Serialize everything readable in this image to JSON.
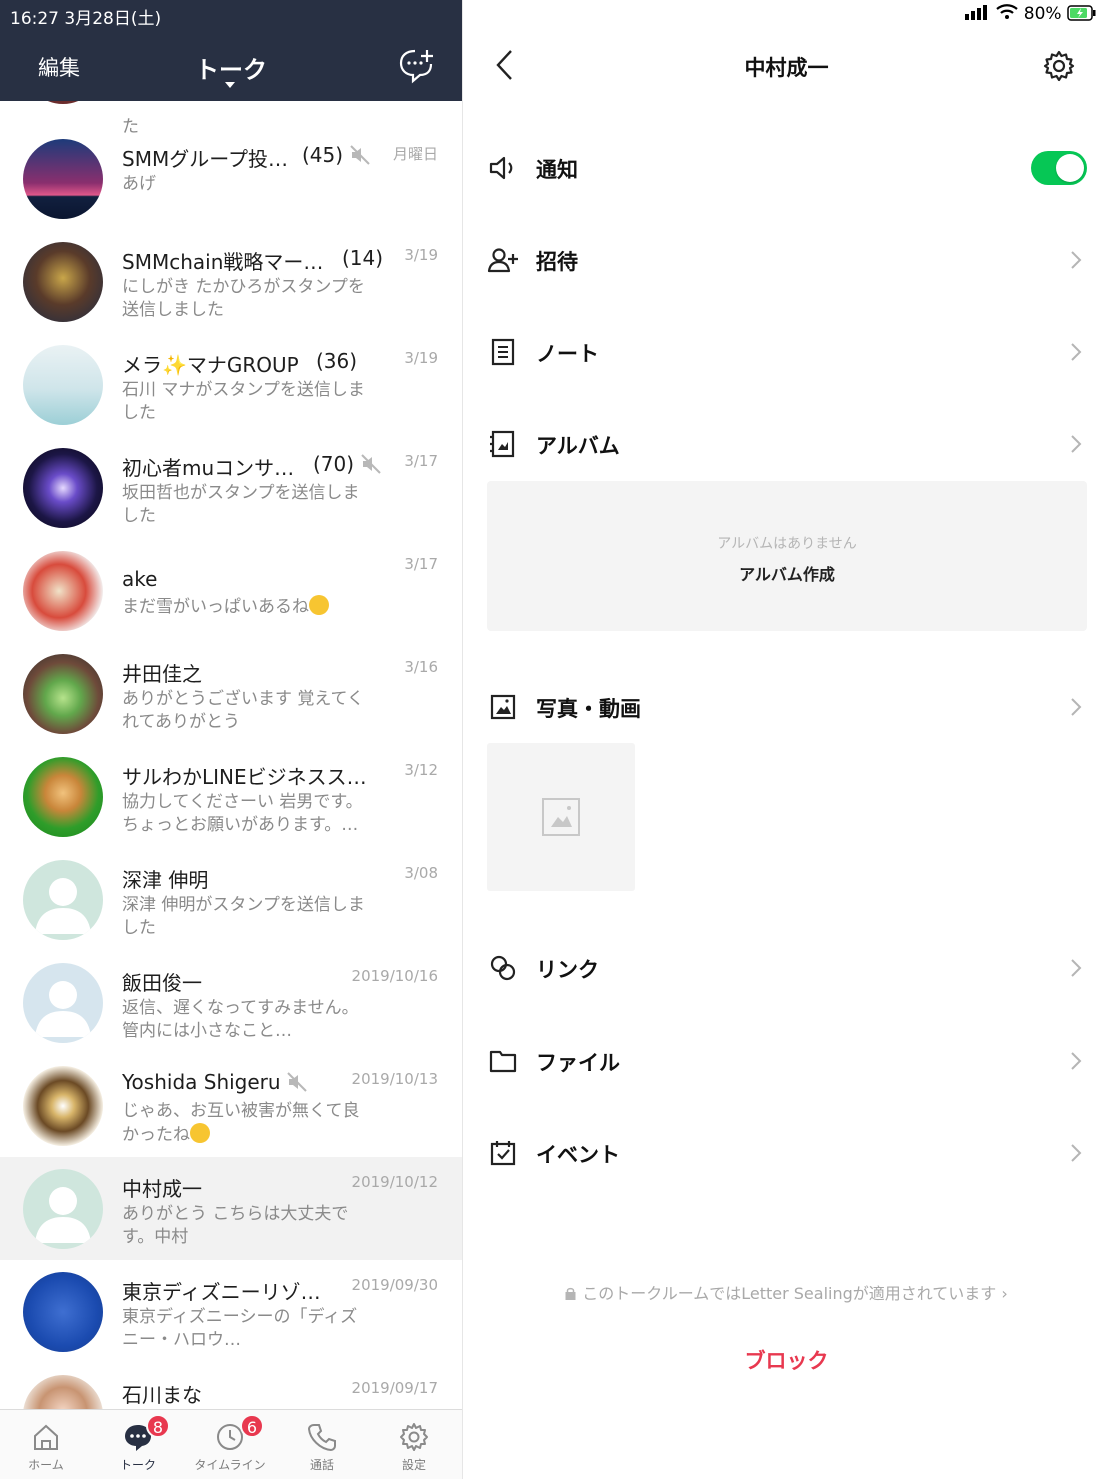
{
  "status_bar": {
    "time_date": "16:27  3月28日(土)",
    "battery": "80%"
  },
  "left_header": {
    "edit_label": "編集",
    "title": "トーク"
  },
  "chats": [
    {
      "name": "SMMグループ投…",
      "count": "(45)",
      "date": "月曜日",
      "message": "あげ",
      "muted": true
    },
    {
      "name": "SMMchain戦略マー…",
      "count": "(14)",
      "date": "3/19",
      "message": "にしがき たかひろがスタンプを送信しました",
      "muted": false
    },
    {
      "name": "メラ✨マナGROUP",
      "count": "(36)",
      "date": "3/19",
      "message": "石川 マナがスタンプを送信しました",
      "muted": false
    },
    {
      "name": "初心者muコンサ…",
      "count": "(70)",
      "date": "3/17",
      "message": "坂田哲也がスタンプを送信しました",
      "muted": true
    },
    {
      "name": "ake",
      "count": "",
      "date": "3/17",
      "message": "まだ雪がいっぱいあるね",
      "muted": false
    },
    {
      "name": "井田佳之",
      "count": "",
      "date": "3/16",
      "message": "ありがとうございます 覚えてくれてありがとう",
      "muted": false
    },
    {
      "name": "サルわかLINEビジネスス…",
      "count": "",
      "date": "3/12",
      "message": "協力してくださーい 岩男です。ちょっとお願いがあります。…",
      "muted": false
    },
    {
      "name": "深津 伸明",
      "count": "",
      "date": "3/08",
      "message": "深津 伸明がスタンプを送信しました",
      "muted": false
    },
    {
      "name": "飯田俊一",
      "count": "",
      "date": "2019/10/16",
      "message": "返信、遅くなってすみません。管内には小さなこと…",
      "muted": false
    },
    {
      "name": "Yoshida Shigeru",
      "count": "",
      "date": "2019/10/13",
      "message": "じゃあ、お互い被害が無くて良かったね",
      "muted": true
    },
    {
      "name": "中村成一",
      "count": "",
      "date": "2019/10/12",
      "message": "ありがとう こちらは大丈夫です。中村",
      "muted": false
    },
    {
      "name": "東京ディズニーリゾ…",
      "count": "",
      "date": "2019/09/30",
      "message": "東京ディズニーシーの「ディズニー・ハロウ…",
      "muted": false
    },
    {
      "name": "石川まな",
      "count": "",
      "date": "2019/09/17",
      "message": "",
      "muted": false
    }
  ],
  "partial_top_msg": "た",
  "tabs": [
    {
      "label": "ホーム",
      "badge": ""
    },
    {
      "label": "トーク",
      "badge": "8"
    },
    {
      "label": "タイムライン",
      "badge": "6"
    },
    {
      "label": "通話",
      "badge": ""
    },
    {
      "label": "設定",
      "badge": ""
    }
  ],
  "right": {
    "title": "中村成一",
    "menu": {
      "notify": "通知",
      "invite": "招待",
      "note": "ノート",
      "album": "アルバム",
      "photos": "写真・動画",
      "links": "リンク",
      "files": "ファイル",
      "events": "イベント"
    },
    "notify_on": true,
    "album_empty": "アルバムはありません",
    "album_create": "アルバム作成",
    "sealing_text": "このトークルームではLetter Sealingが適用されています",
    "block": "ブロック"
  },
  "colors": {
    "header_bg": "#283043",
    "toggle_on": "#06c755",
    "badge": "#e8384f",
    "block": "#e8384f"
  }
}
